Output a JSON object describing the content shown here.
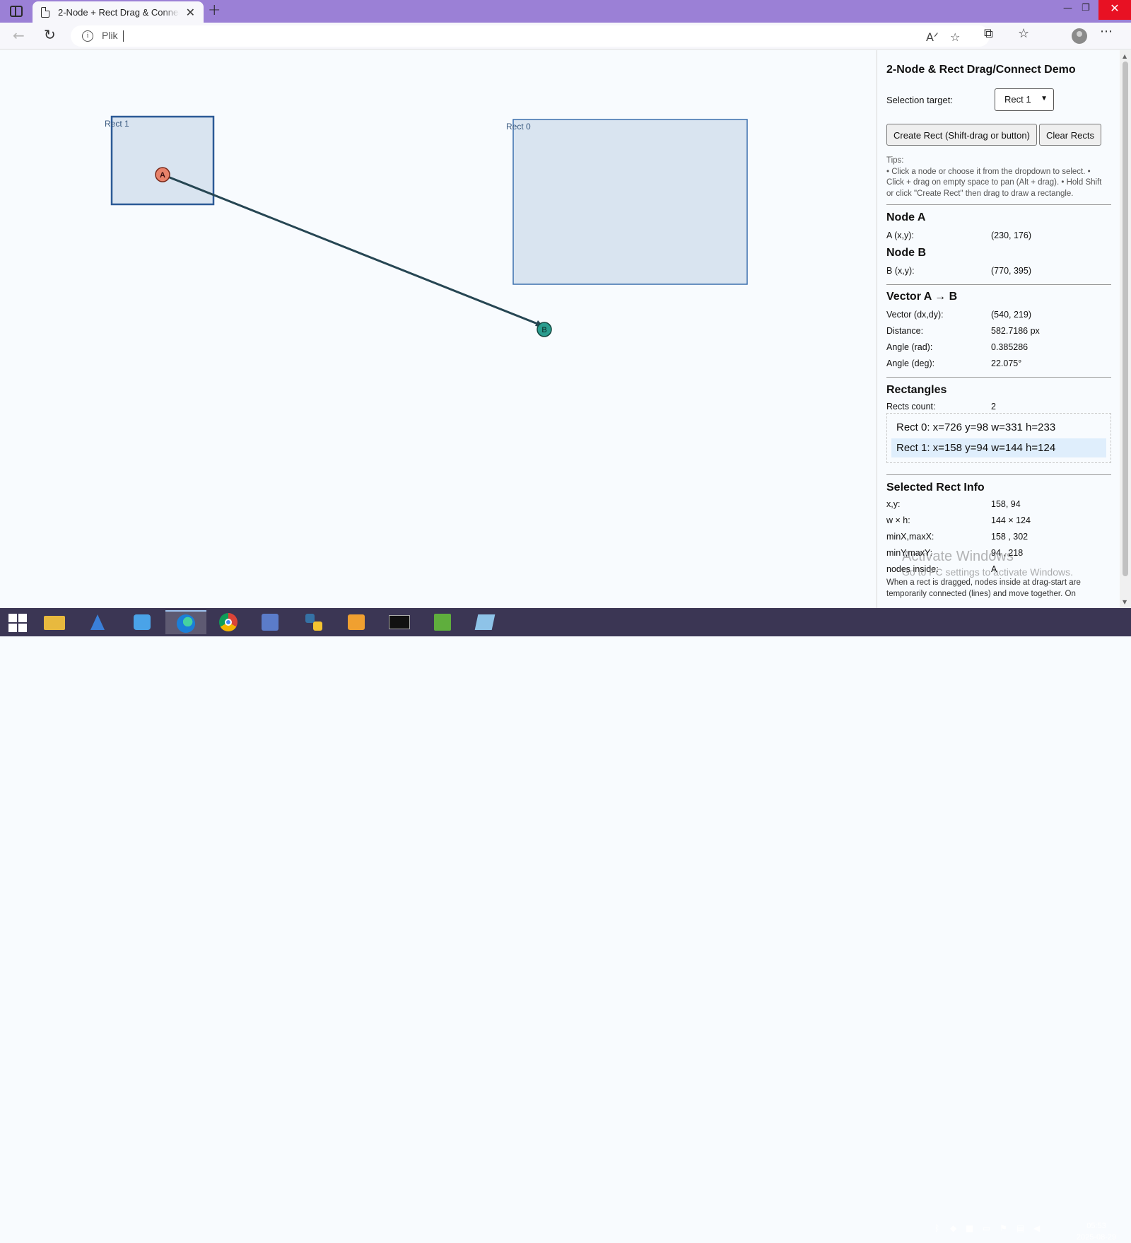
{
  "browser": {
    "tab_title": "2-Node + Rect Drag & Connect Demo",
    "tab_close": "✕",
    "new_tab": "+",
    "url_text": "Plik",
    "min": "—",
    "max": "❐",
    "close": "✕"
  },
  "canvas": {
    "rect0_label": "Rect 0",
    "rect1_label": "Rect 1",
    "node_a_label": "A",
    "node_b_label": "B",
    "colors": {
      "rect_fill": "#d9e4f0",
      "rect_stroke": "#3a6fae",
      "rect_selected_stroke": "#2c5a96",
      "node_a": "#e8826a",
      "node_b": "#2a9d8f",
      "edge": "#264653"
    }
  },
  "panel": {
    "title": "2-Node & Rect Drag/Connect Demo",
    "selection_label": "Selection target:",
    "selection_value": "Rect 1",
    "create_button": "Create Rect (Shift-drag or button)",
    "clear_button": "Clear Rects",
    "tips": "Tips:\n• Click a node or choose it from the dropdown to select. • Click + drag on empty space to pan (Alt + drag). • Hold Shift or click \"Create Rect\" then drag to draw a rectangle.",
    "node_a": {
      "heading": "Node A",
      "key": "A (x,y):",
      "value": "(230, 176)"
    },
    "node_b": {
      "heading": "Node B",
      "key": "B (x,y):",
      "value": "(770, 395)"
    },
    "vector": {
      "heading": "Vector A → B",
      "rows": [
        {
          "k": "Vector (dx,dy):",
          "v": "(540, 219)"
        },
        {
          "k": "Distance:",
          "v": "582.7186 px"
        },
        {
          "k": "Angle (rad):",
          "v": "0.385286"
        },
        {
          "k": "Angle (deg):",
          "v": "22.075°"
        }
      ]
    },
    "rectangles": {
      "heading": "Rectangles",
      "count_key": "Rects count:",
      "count_value": "2",
      "items": [
        "Rect 0: x=726 y=98 w=331 h=233",
        "Rect 1: x=158 y=94 w=144 h=124"
      ],
      "selected_index": 1
    },
    "selected_rect": {
      "heading": "Selected Rect Info",
      "rows": [
        {
          "k": "x,y:",
          "v": "158, 94"
        },
        {
          "k": "w × h:",
          "v": "144 × 124"
        },
        {
          "k": "minX,maxX:",
          "v": "158 , 302"
        },
        {
          "k": "minY,maxY:",
          "v": "94 , 218"
        },
        {
          "k": "nodes inside:",
          "v": "A"
        }
      ]
    },
    "footer": "When a rect is dragged, nodes inside at drag-start are temporarily connected (lines) and move together. On"
  },
  "watermark": {
    "line1": "Activate Windows",
    "line2": "Go to PC settings to activate Windows."
  },
  "taskbar": {
    "time": "05:53",
    "date": "2025-08-29"
  }
}
